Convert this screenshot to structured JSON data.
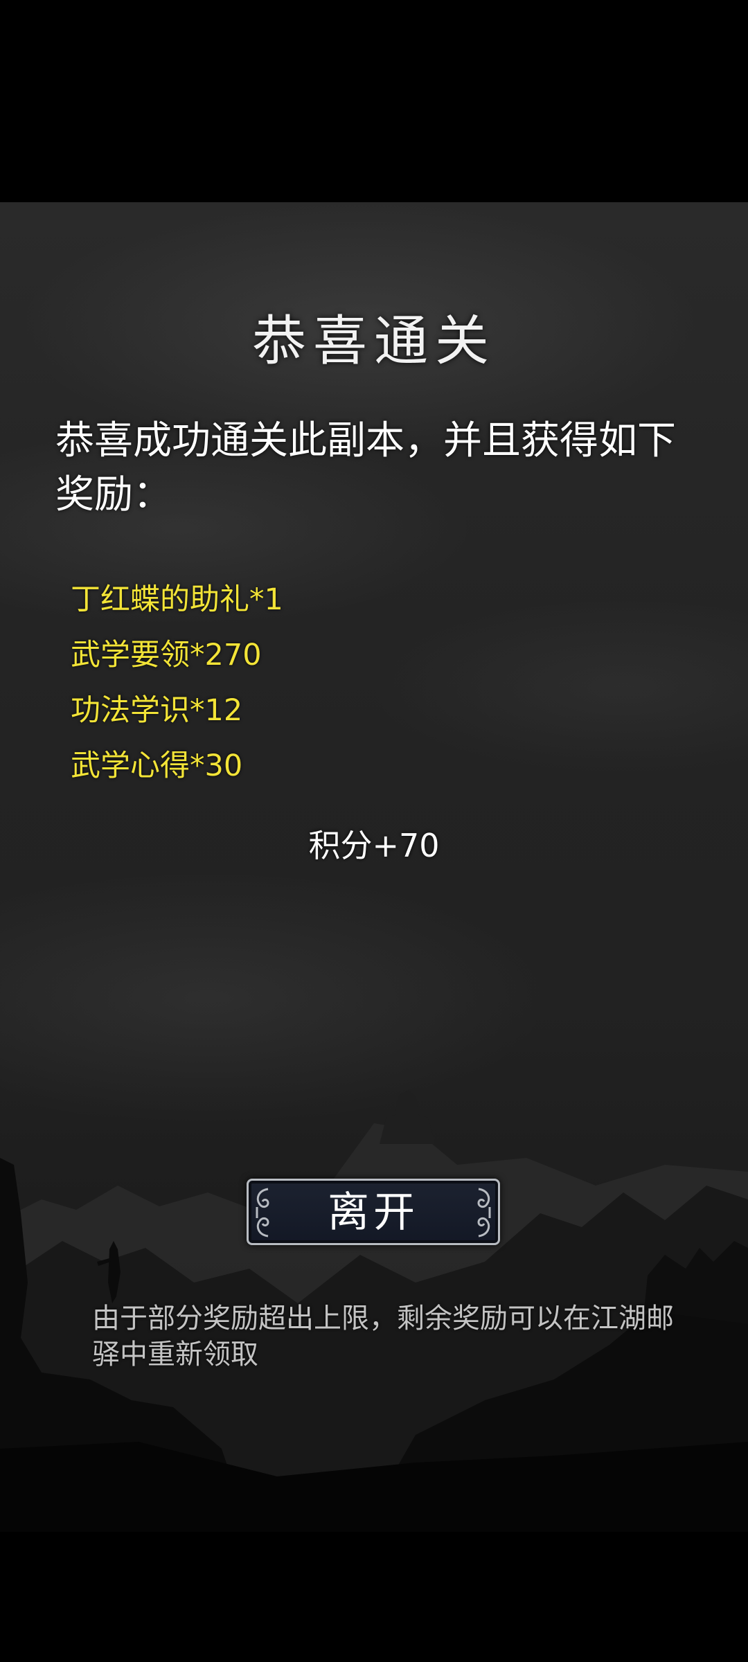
{
  "dialog": {
    "title": "恭喜通关",
    "message": "恭喜成功通关此副本，并且获得如下奖励：",
    "rewards": [
      "丁红蝶的助礼*1",
      "武学要领*270",
      "功法学识*12",
      "武学心得*30"
    ],
    "score": "积分+70",
    "leave_button": "离开",
    "notice": "由于部分奖励超出上限，剩余奖励可以在江湖邮驿中重新领取"
  },
  "colors": {
    "reward_text": "#f3e437",
    "title_text": "#f2f2f2",
    "button_bg": "#161b28",
    "button_border": "#b8bcc2",
    "notice_text": "#c4c4c4"
  }
}
